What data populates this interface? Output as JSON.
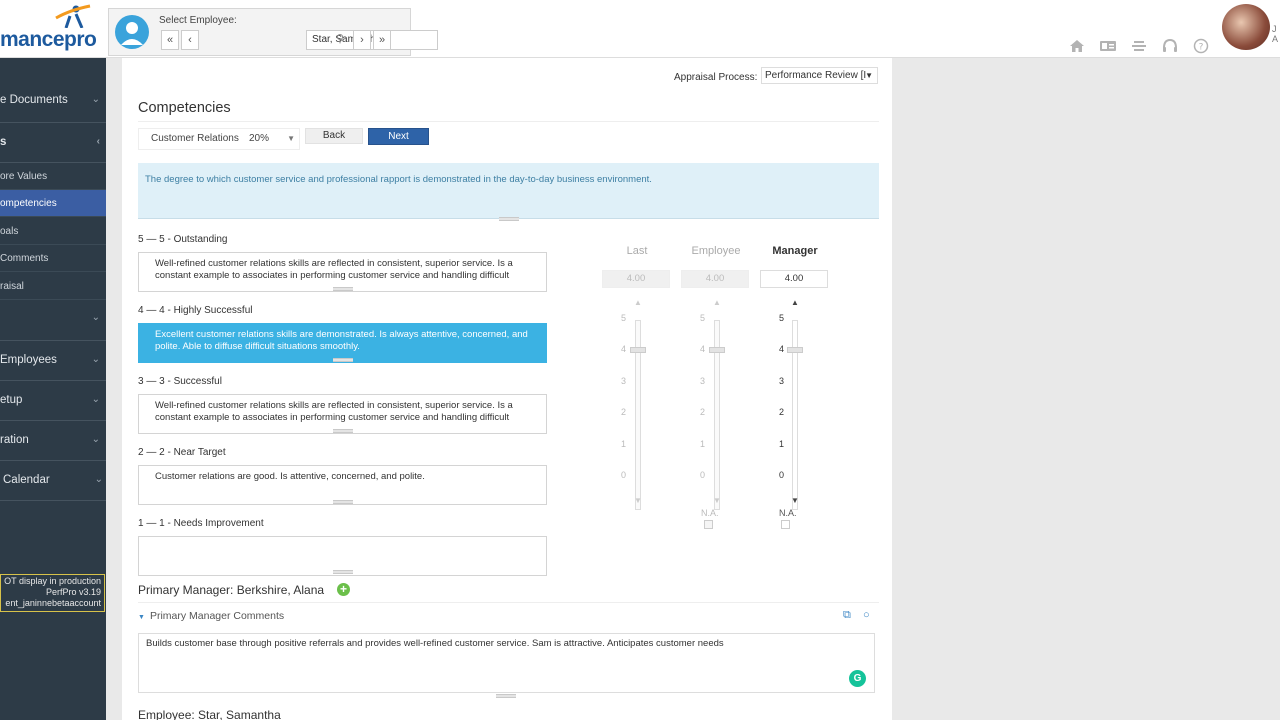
{
  "header": {
    "logo_text": "mancepro",
    "employee_label": "Select Employee:",
    "employee_value": "Star, Samantha",
    "nav_first": "«",
    "nav_prev": "‹",
    "nav_next": "›",
    "nav_last": "»",
    "icons": [
      "home-icon",
      "id-card-icon",
      "list-icon",
      "headset-icon",
      "help-icon"
    ],
    "user_name_fragment": "J",
    "user_name_fragment2": "A"
  },
  "sidebar": {
    "items": [
      {
        "label": "e Documents",
        "name": "sidebar-item-documents"
      },
      {
        "label": "s",
        "name": "sidebar-item-appraisals"
      },
      {
        "label": "",
        "name": "sidebar-item-collapsed"
      },
      {
        "label": "Employees",
        "name": "sidebar-item-employees"
      },
      {
        "label": "etup",
        "name": "sidebar-item-setup"
      },
      {
        "label": "ration",
        "name": "sidebar-item-administration"
      },
      {
        "label": "Calendar",
        "name": "sidebar-item-calendar"
      }
    ],
    "sub_items": [
      {
        "label": "ore Values",
        "active": false
      },
      {
        "label": "ompetencies",
        "active": true
      },
      {
        "label": "oals",
        "active": false
      },
      {
        "label": "Comments",
        "active": false
      },
      {
        "label": "raisal",
        "active": false
      }
    ],
    "env_note": {
      "line1": "OT display in production",
      "line2": "PerfPro v3.19",
      "line3": "ent_janinnebetaaccount"
    }
  },
  "main": {
    "appraisal_label": "Appraisal Process:",
    "appraisal_value": "Performance Review [I",
    "page_title": "Competencies",
    "competency_name": "Customer Relations",
    "competency_weight": "20%",
    "back_label": "Back",
    "next_label": "Next",
    "description": "The degree to which customer service and professional rapport is demonstrated in the day-to-day business environment.",
    "ratings": [
      {
        "head": "5 — 5 - Outstanding",
        "text": "Well-refined customer relations skills are reflected in consistent, superior service. Is a constant example to associates in performing customer service and handling difficult",
        "selected": false
      },
      {
        "head": "4 — 4 - Highly Successful",
        "text": "Excellent customer relations skills are demonstrated. Is always attentive, concerned, and polite. Able to diffuse difficult situations smoothly.",
        "selected": true
      },
      {
        "head": "3 — 3 - Successful",
        "text": "Well-refined customer relations skills are reflected in consistent, superior service. Is a constant example to associates in performing customer service and handling difficult",
        "selected": false
      },
      {
        "head": "2 — 2 - Near Target",
        "text": "Customer relations are good. Is attentive, concerned, and polite.",
        "selected": false
      },
      {
        "head": "1 — 1 - Needs Improvement",
        "text": "",
        "selected": false
      }
    ],
    "score_columns": [
      {
        "head": "Last",
        "score": "4.00",
        "value": 4,
        "na": "",
        "active": false
      },
      {
        "head": "Employee",
        "score": "4.00",
        "value": 4,
        "na": "N.A.",
        "active": false
      },
      {
        "head": "Manager",
        "score": "4.00",
        "value": 4,
        "na": "N.A.",
        "active": true
      }
    ],
    "scale_ticks": [
      "5",
      "4",
      "3",
      "2",
      "1",
      "0"
    ],
    "primary_manager_heading": "Primary Manager: Berkshire, Alana",
    "manager_comments_heading": "Primary Manager Comments",
    "manager_comment": "Builds customer base through positive referrals and provides well-refined customer service. Sam is attractive. Anticipates customer needs",
    "employee_heading": "Employee: Star, Samantha"
  },
  "colors": {
    "sidebar_bg": "#2d3b47",
    "active_sub": "#3b5ea3",
    "selected_rating": "#3bb2e3",
    "next_button": "#2e63a8",
    "description_bg": "#dff0f8"
  }
}
